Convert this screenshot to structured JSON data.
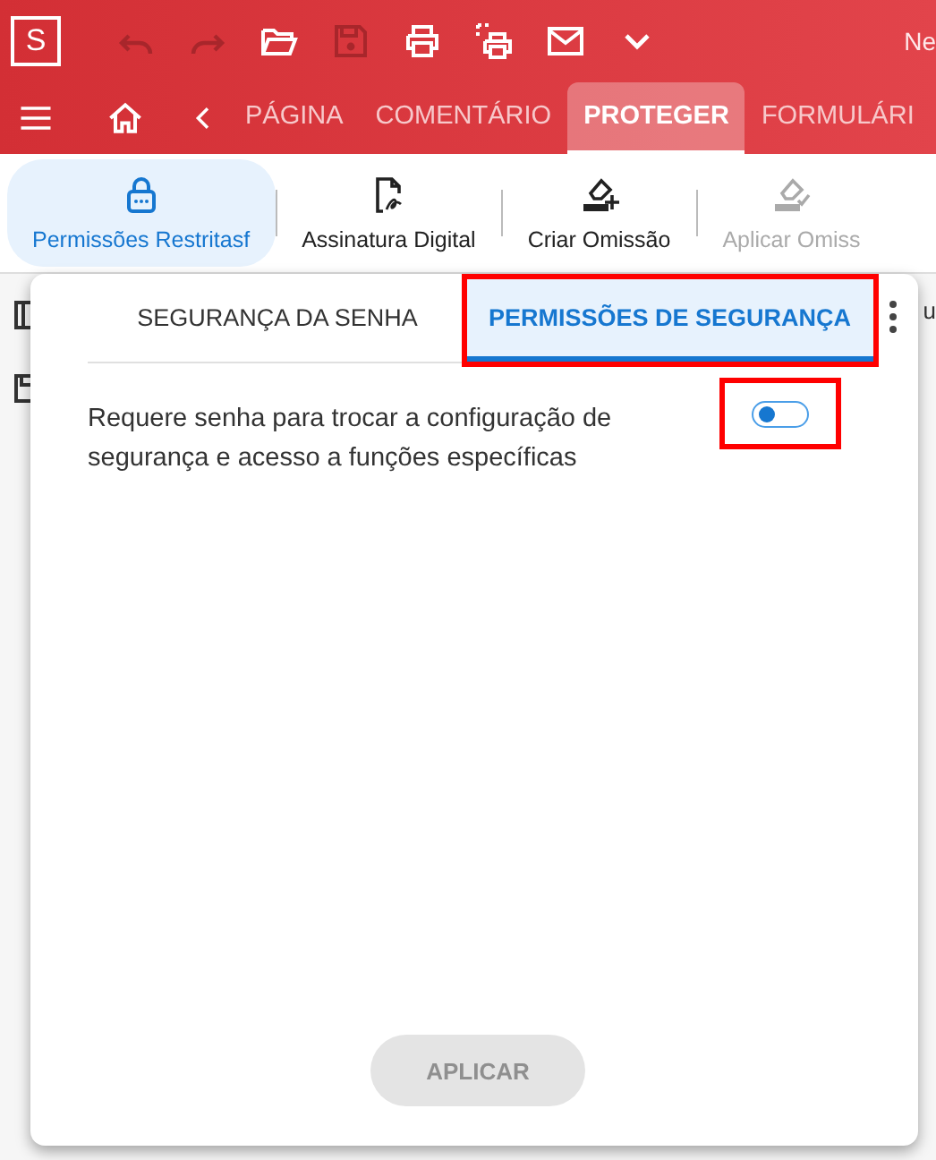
{
  "app": {
    "logo": "S",
    "title_fragment": "Ne"
  },
  "quick_access": [
    {
      "kind": "undo",
      "disabled": true
    },
    {
      "kind": "redo",
      "disabled": true
    },
    {
      "kind": "open",
      "disabled": false
    },
    {
      "kind": "save",
      "disabled": true
    },
    {
      "kind": "print",
      "disabled": false
    },
    {
      "kind": "print-area",
      "disabled": false
    },
    {
      "kind": "mail",
      "disabled": false
    },
    {
      "kind": "more",
      "disabled": false
    }
  ],
  "ribbon_tabs": [
    {
      "label": "PÁGINA",
      "selected": false
    },
    {
      "label": "COMENTÁRIO",
      "selected": false
    },
    {
      "label": "PROTEGER",
      "selected": true
    },
    {
      "label": "FORMULÁRI",
      "selected": false
    }
  ],
  "toolbar": [
    {
      "kind": "lock",
      "label": "Permissões Restritasf",
      "selected": true,
      "disabled": false
    },
    {
      "kind": "signature",
      "label": "Assinatura Digital",
      "selected": false,
      "disabled": false
    },
    {
      "kind": "eraser-add",
      "label": "Criar Omissão",
      "selected": false,
      "disabled": false
    },
    {
      "kind": "eraser-check",
      "label": "Aplicar Omiss",
      "selected": false,
      "disabled": true
    }
  ],
  "background_fragment": "u",
  "dialog": {
    "tabs": [
      {
        "label": "SEGURANÇA DA SENHA",
        "selected": false,
        "highlighted": false
      },
      {
        "label": "PERMISSÕES DE SEGURANÇA",
        "selected": true,
        "highlighted": true
      }
    ],
    "setting": {
      "label": "Requere senha para trocar a configuração de segurança e acesso a funções específicas",
      "on": false,
      "highlighted": true
    },
    "button": {
      "label": "APLICAR",
      "disabled": true
    }
  }
}
